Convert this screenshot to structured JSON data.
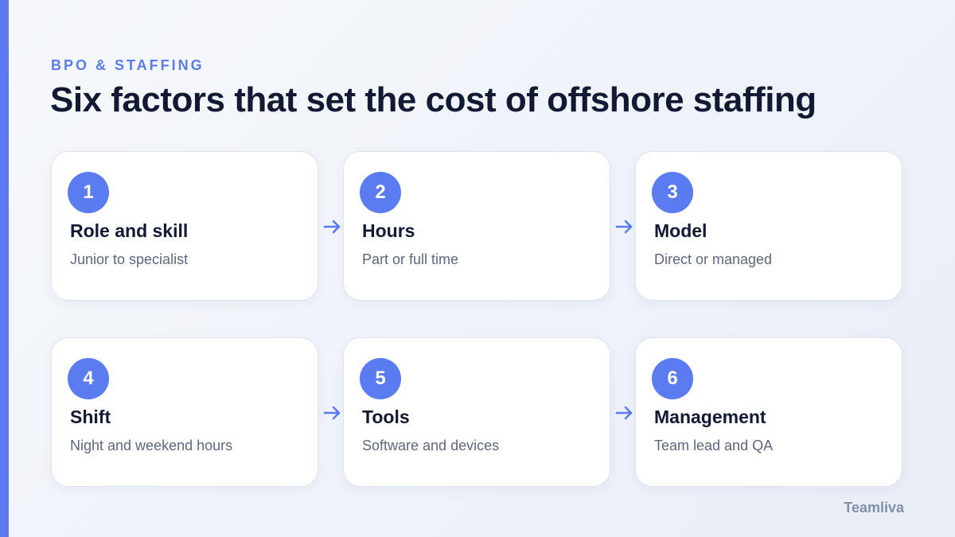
{
  "header": {
    "eyebrow": "BPO & STAFFING",
    "title": "Six factors that set the cost of offshore staffing"
  },
  "factors": [
    {
      "number": "1",
      "title": "Role and skill",
      "subtitle": "Junior to specialist"
    },
    {
      "number": "2",
      "title": "Hours",
      "subtitle": "Part or full time"
    },
    {
      "number": "3",
      "title": "Model",
      "subtitle": "Direct or managed"
    },
    {
      "number": "4",
      "title": "Shift",
      "subtitle": "Night and weekend hours"
    },
    {
      "number": "5",
      "title": "Tools",
      "subtitle": "Software and devices"
    },
    {
      "number": "6",
      "title": "Management",
      "subtitle": "Team lead and QA"
    }
  ],
  "brand": "Teamliva",
  "colors": {
    "accent": "#5b7cf0",
    "heading": "#121a33",
    "muted": "#5d6780",
    "card_border": "#dde3ef",
    "background": "#eef2f9"
  },
  "icons": [
    "arrow-right-icon"
  ]
}
